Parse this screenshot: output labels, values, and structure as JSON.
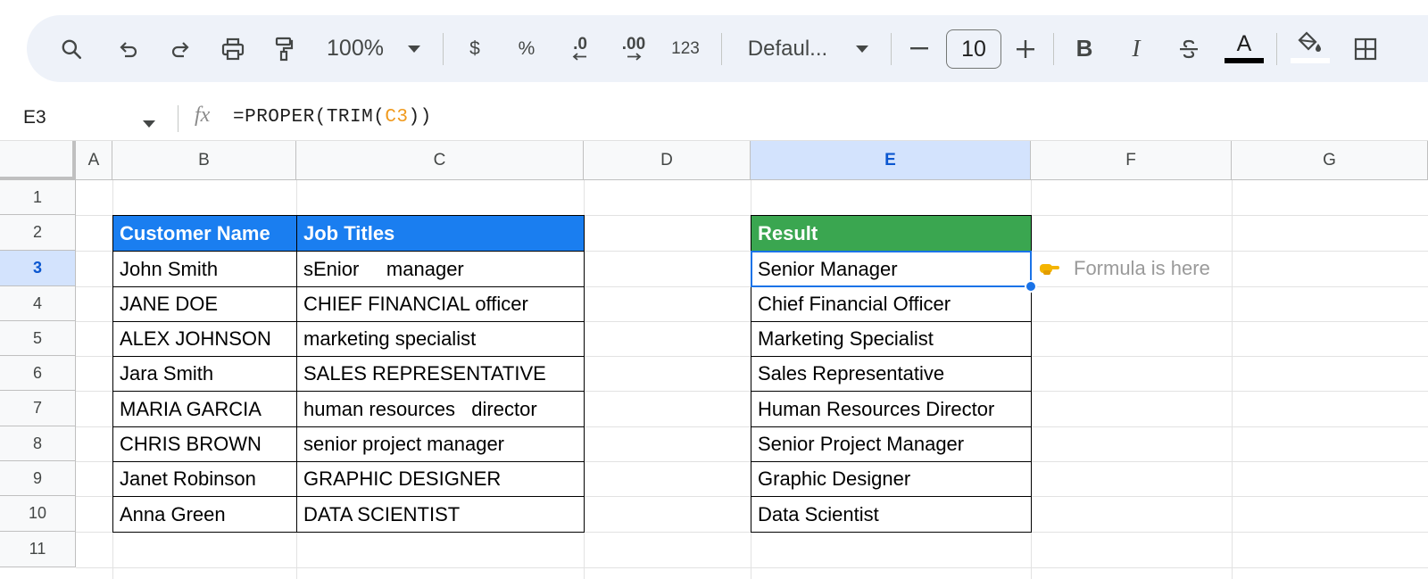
{
  "toolbar": {
    "zoom": "100%",
    "currency": "$",
    "percent": "%",
    "decrease_decimal": ".0",
    "increase_decimal": ".00",
    "number_format": "123",
    "font": "Defaul...",
    "font_size": "10",
    "bold": "B",
    "italic": "I",
    "text_color_letter": "A",
    "icons": [
      "search-icon",
      "undo-icon",
      "redo-icon",
      "print-icon",
      "paint-format-icon",
      "chevron-down-icon",
      "minus-icon",
      "plus-icon",
      "strikethrough-icon",
      "fill-color-icon",
      "borders-icon"
    ]
  },
  "formula_bar": {
    "cell_ref": "E3",
    "fx": "fx",
    "formula_prefix": "=PROPER(TRIM(",
    "formula_ref": "C3",
    "formula_suffix": "))"
  },
  "columns": [
    "A",
    "B",
    "C",
    "D",
    "E",
    "F",
    "G"
  ],
  "active_column": "E",
  "rows": [
    "1",
    "2",
    "3",
    "4",
    "5",
    "6",
    "7",
    "8",
    "9",
    "10",
    "11"
  ],
  "active_row": "3",
  "table": {
    "header_name": "Customer Name",
    "header_title": "Job Titles",
    "names": [
      "John Smith",
      "JANE DOE",
      "ALEX JOHNSON",
      "Jara Smith",
      "MARIA GARCIA",
      "CHRIS BROWN",
      "Janet Robinson",
      "Anna Green"
    ],
    "titles": [
      "sEnior     manager",
      "CHIEF FINANCIAL officer",
      "marketing specialist",
      "SALES REPRESENTATIVE",
      "human resources   director",
      "senior project manager",
      "GRAPHIC DESIGNER",
      "DATA SCIENTIST"
    ]
  },
  "result": {
    "header": "Result",
    "values": [
      "Senior Manager",
      "Chief Financial Officer",
      "Marketing Specialist",
      "Sales Representative",
      "Human Resources Director",
      "Senior Project Manager",
      "Graphic Designer",
      "Data Scientist"
    ]
  },
  "note": "Formula is here",
  "colors": {
    "header_blue": "#1a7ef0",
    "header_green": "#3aa650",
    "selection": "#1a73e8",
    "toolbar_bg": "#eef2f9",
    "formula_ref": "#f09a1e"
  }
}
